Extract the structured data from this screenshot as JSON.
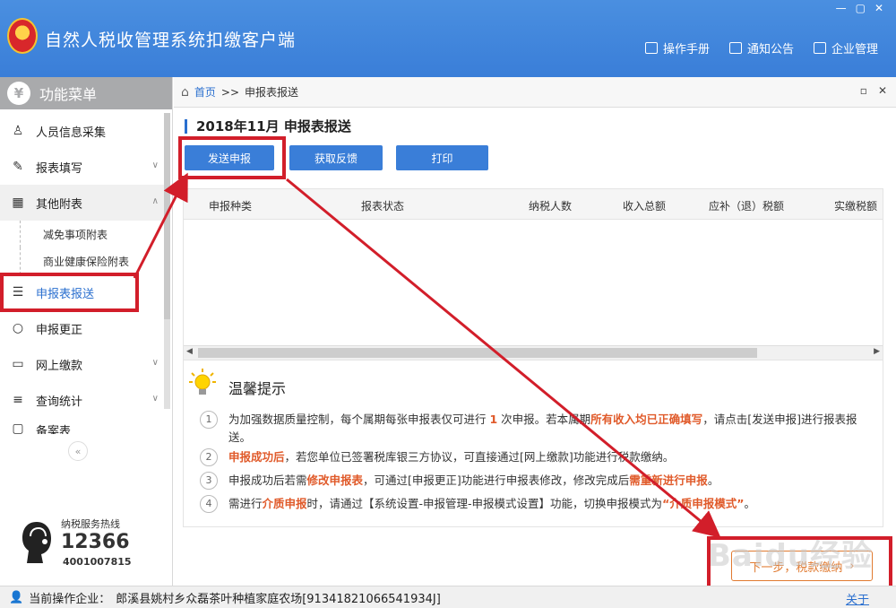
{
  "app": {
    "title": "自然人税收管理系统扣缴客户端"
  },
  "window_controls": [
    "—",
    "▢",
    "✕"
  ],
  "top_nav": [
    {
      "label": "操作手册",
      "icon": "manual-icon"
    },
    {
      "label": "通知公告",
      "icon": "mail-icon"
    },
    {
      "label": "企业管理",
      "icon": "building-icon"
    }
  ],
  "sidebar": {
    "header": "功能菜单",
    "header_icon_glyph": "¥",
    "items": [
      {
        "label": "人员信息采集",
        "icon": "person-icon",
        "glyph": "♙"
      },
      {
        "label": "报表填写",
        "icon": "edit-icon",
        "glyph": "✎"
      },
      {
        "label": "其他附表",
        "icon": "grid-icon",
        "glyph": "▦"
      },
      {
        "label": "减免事项附表"
      },
      {
        "label": "商业健康保险附表"
      },
      {
        "label": "申报表报送",
        "icon": "report-send-icon",
        "glyph": "☰"
      },
      {
        "label": "申报更正",
        "icon": "search-icon",
        "glyph": "○"
      },
      {
        "label": "网上缴款",
        "icon": "folder-icon",
        "glyph": "▭"
      },
      {
        "label": "查询统计",
        "icon": "query-icon",
        "glyph": "≡"
      },
      {
        "label": "备案表",
        "icon": "archive-icon",
        "glyph": "▢"
      }
    ],
    "collapse_glyph": "«",
    "hotline": {
      "label": "纳税服务热线",
      "number": "12366",
      "phone": "4001007815"
    }
  },
  "breadcrumb": {
    "home": "首页",
    "sep": ">>",
    "current": "申报表报送"
  },
  "page": {
    "title": "2018年11月  申报表报送"
  },
  "buttons": {
    "send": "发送申报",
    "feedback": "获取反馈",
    "print": "打印"
  },
  "table": {
    "columns": [
      "申报种类",
      "报表状态",
      "纳税人数",
      "收入总额",
      "应补（退）税额",
      "实缴税额"
    ]
  },
  "tips": {
    "title": "温馨提示",
    "rows": [
      {
        "num": "1",
        "parts": [
          "为加强数据质量控制，每个属期每张申报表仅可进行 ",
          "1",
          " 次申报。若本属期",
          "所有收入均已正确填写",
          "，请点击[发送申报]进行报表报送。"
        ]
      },
      {
        "num": "2",
        "parts": [
          "申报成功后",
          "，若您单位已签署税库银三方协议，可直接通过[网上缴款]功能进行税款缴纳。"
        ]
      },
      {
        "num": "3",
        "parts": [
          "申报成功后若需",
          "修改申报表",
          "，可通过[申报更正]功能进行申报表修改，修改完成后",
          "需重新进行申报",
          "。"
        ]
      },
      {
        "num": "4",
        "parts": [
          "需进行",
          "介质申报",
          "时，请通过【系统设置-申报管理-申报模式设置】功能，切换申报模式为",
          "“介质申报模式”",
          "。"
        ]
      }
    ]
  },
  "next_button": {
    "label": "下一步，税款缴纳",
    "glyph": "›"
  },
  "footer": {
    "label": "当前操作企业：",
    "company": "郎溪县姚村乡众磊茶叶种植家庭农场[91341821066541934J]",
    "about": "关于"
  },
  "watermark": "Baidu经验",
  "colors": {
    "header": "#3a7ed8",
    "annotation": "#d21e2a",
    "highlight": "#e05a2a"
  }
}
